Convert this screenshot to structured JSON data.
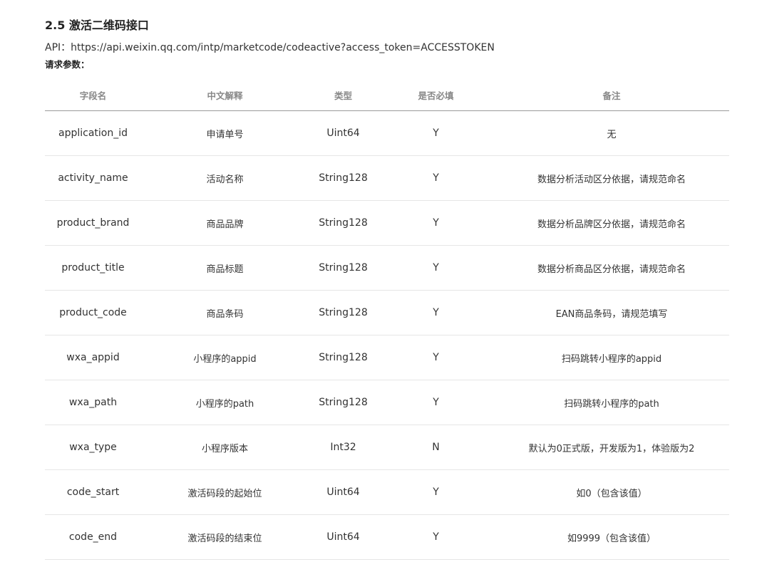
{
  "section": {
    "title": "2.5 激活二维码接口",
    "api_label": "API：",
    "api_url": "https://api.weixin.qq.com/intp/marketcode/codeactive?access_token=ACCESSTOKEN",
    "params_label": "请求参数："
  },
  "table": {
    "headers": [
      "字段名",
      "中文解释",
      "类型",
      "是否必填",
      "备注"
    ],
    "rows": [
      [
        "application_id",
        "申请单号",
        "Uint64",
        "Y",
        "无"
      ],
      [
        "activity_name",
        "活动名称",
        "String128",
        "Y",
        "数据分析活动区分依据，请规范命名"
      ],
      [
        "product_brand",
        "商品品牌",
        "String128",
        "Y",
        "数据分析品牌区分依据，请规范命名"
      ],
      [
        "product_title",
        "商品标题",
        "String128",
        "Y",
        "数据分析商品区分依据，请规范命名"
      ],
      [
        "product_code",
        "商品条码",
        "String128",
        "Y",
        "EAN商品条码，请规范填写"
      ],
      [
        "wxa_appid",
        "小程序的appid",
        "String128",
        "Y",
        "扫码跳转小程序的appid"
      ],
      [
        "wxa_path",
        "小程序的path",
        "String128",
        "Y",
        "扫码跳转小程序的path"
      ],
      [
        "wxa_type",
        "小程序版本",
        "Int32",
        "N",
        "默认为0正式版，开发版为1，体验版为2"
      ],
      [
        "code_start",
        "激活码段的起始位",
        "Uint64",
        "Y",
        "如0（包含该值）"
      ],
      [
        "code_end",
        "激活码段的结束位",
        "Uint64",
        "Y",
        "如9999（包含该值）"
      ]
    ]
  }
}
